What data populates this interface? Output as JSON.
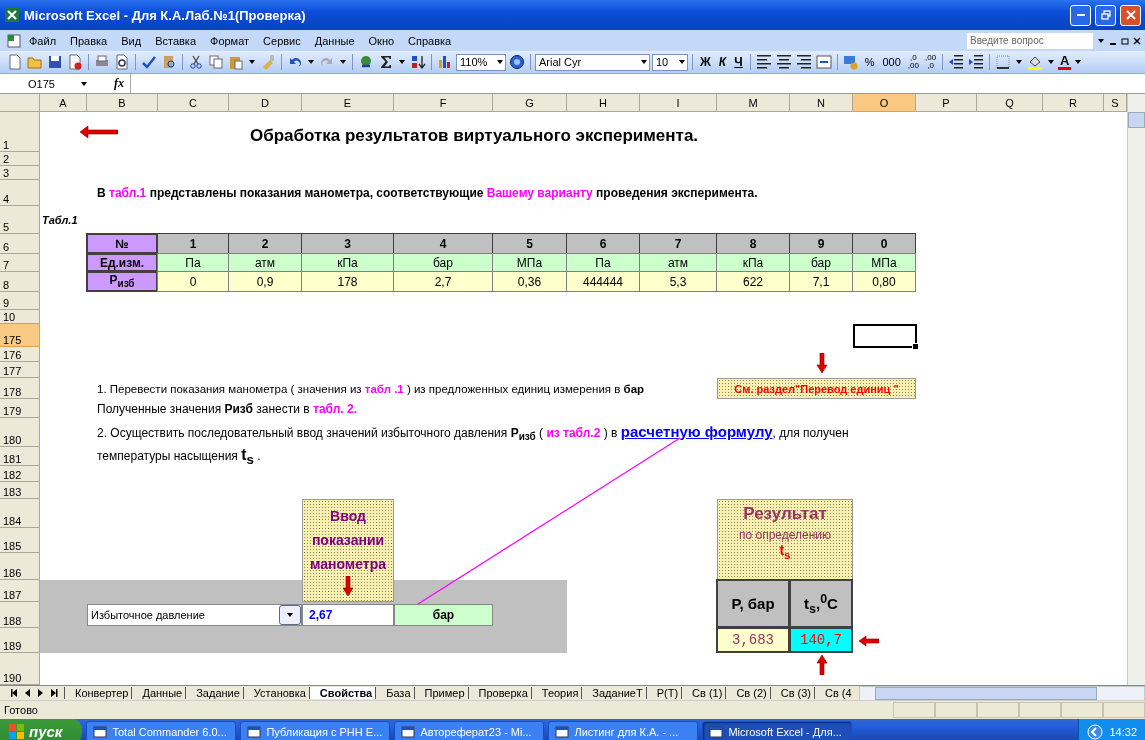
{
  "window": {
    "title": "Microsoft Excel - Для К.А.Лаб.№1(Проверка)"
  },
  "menu": [
    "Файл",
    "Правка",
    "Вид",
    "Вставка",
    "Формат",
    "Сервис",
    "Данные",
    "Окно",
    "Справка"
  ],
  "help_search": {
    "placeholder": "Введите вопрос"
  },
  "toolbar": {
    "zoom": "110%",
    "font": "Arial Cyr",
    "size": "10",
    "style_buttons": [
      "Ж",
      "К",
      "Ч"
    ],
    "number_buttons": [
      "%",
      "000"
    ],
    "decimal_buttons": [
      {
        "top": ",0",
        "bottom": ",00"
      },
      {
        "top": ",00",
        "bottom": ",0"
      }
    ],
    "font_color": "A"
  },
  "formula_bar": {
    "name_box": "O175",
    "fx": "fx"
  },
  "columns": [
    {
      "label": "A",
      "selected": false
    },
    {
      "label": "B",
      "selected": false
    },
    {
      "label": "C",
      "selected": false
    },
    {
      "label": "D",
      "selected": false
    },
    {
      "label": "E",
      "selected": false
    },
    {
      "label": "F",
      "selected": false
    },
    {
      "label": "G",
      "selected": false
    },
    {
      "label": "H",
      "selected": false
    },
    {
      "label": "I",
      "selected": false
    },
    {
      "label": "M",
      "selected": false
    },
    {
      "label": "N",
      "selected": false
    },
    {
      "label": "O",
      "selected": true
    },
    {
      "label": "P",
      "selected": false
    },
    {
      "label": "Q",
      "selected": false
    },
    {
      "label": "R",
      "selected": false
    },
    {
      "label": "S",
      "selected": false
    }
  ],
  "rows": [
    {
      "label": "1",
      "selected": false
    },
    {
      "label": "2",
      "selected": false
    },
    {
      "label": "3",
      "selected": false
    },
    {
      "label": "4",
      "selected": false
    },
    {
      "label": "5",
      "selected": false
    },
    {
      "label": "6",
      "selected": false
    },
    {
      "label": "7",
      "selected": false
    },
    {
      "label": "8",
      "selected": false
    },
    {
      "label": "9",
      "selected": false
    },
    {
      "label": "10",
      "selected": false
    },
    {
      "label": "175",
      "selected": true
    },
    {
      "label": "176",
      "selected": false
    },
    {
      "label": "177",
      "selected": false
    },
    {
      "label": "178",
      "selected": false
    },
    {
      "label": "179",
      "selected": false
    },
    {
      "label": "180",
      "selected": false
    },
    {
      "label": "181",
      "selected": false
    },
    {
      "label": "182",
      "selected": false
    },
    {
      "label": "183",
      "selected": false
    },
    {
      "label": "184",
      "selected": false
    },
    {
      "label": "185",
      "selected": false
    },
    {
      "label": "186",
      "selected": false
    },
    {
      "label": "187",
      "selected": false
    },
    {
      "label": "188",
      "selected": false
    },
    {
      "label": "189",
      "selected": false
    },
    {
      "label": "190",
      "selected": false
    }
  ],
  "sheet": {
    "heading": "Обработка результатов виртуального эксперимента.",
    "intro": [
      {
        "kind": "plain",
        "text": "В "
      },
      {
        "kind": "hl",
        "text": "табл.1"
      },
      {
        "kind": "plain",
        "text": " представлены показания манометра, соответствующие "
      },
      {
        "kind": "hl",
        "text": "Вашему варианту"
      },
      {
        "kind": "plain",
        "text": " проведения эксперимента."
      }
    ],
    "table_label": "Табл.1",
    "table1": {
      "row_headers": [
        "№",
        "Ед.изм.",
        "P$_{изб}$"
      ],
      "columns": [
        {
          "variant": "1",
          "unit": "Па",
          "value": "0"
        },
        {
          "variant": "2",
          "unit": "атм",
          "value": "0,9"
        },
        {
          "variant": "3",
          "unit": "кПа",
          "value": "178"
        },
        {
          "variant": "4",
          "unit": "бар",
          "value": "2,7"
        },
        {
          "variant": "5",
          "unit": "МПа",
          "value": "0,36"
        },
        {
          "variant": "6",
          "unit": "Па",
          "value": "444444"
        },
        {
          "variant": "7",
          "unit": "атм",
          "value": "5,3"
        },
        {
          "variant": "8",
          "unit": "кПа",
          "value": "622"
        },
        {
          "variant": "9",
          "unit": "бар",
          "value": "7,1"
        },
        {
          "variant": "0",
          "unit": "МПа",
          "value": "0,80"
        }
      ]
    },
    "step1": [
      {
        "kind": "plain",
        "text": "1. Перевести показания манометра ( значения из "
      },
      {
        "kind": "hl",
        "text": "табл .1"
      },
      {
        "kind": "plain",
        "text": " ) из предложенных единиц измерения в "
      },
      {
        "kind": "bold",
        "text": "бар"
      }
    ],
    "note": "См. раздел\"Перевод единиц \"",
    "step1b": [
      {
        "kind": "plain",
        "text": "Полученные значения "
      },
      {
        "kind": "bold",
        "text": "Ризб"
      },
      {
        "kind": "plain",
        "text": " занести в "
      },
      {
        "kind": "hl",
        "text": "табл. 2."
      }
    ],
    "step2": [
      {
        "kind": "plain",
        "text": "2. Осуществить последовательный ввод значений избыточного давления "
      },
      {
        "kind": "bold",
        "text": "P$_{изб}$"
      },
      {
        "kind": "plain",
        "text": " ( "
      },
      {
        "kind": "hl",
        "text": "из табл.2"
      },
      {
        "kind": "plain",
        "text": " )  в "
      },
      {
        "kind": "link",
        "text": "расчетную формулу"
      },
      {
        "kind": "plain",
        "text": ", для получен"
      }
    ],
    "step2b": [
      {
        "kind": "plain",
        "text": "температуры насыщения "
      },
      {
        "kind": "big",
        "text": "t$_{s}$"
      },
      {
        "kind": "plain",
        "text": " ."
      }
    ],
    "input_panel": {
      "header": "Ввод показании манометра",
      "dropdown": "Избыточное давление",
      "value": "2,67",
      "unit": "бар"
    },
    "result": {
      "title": "Результат",
      "subtitle": "по определению",
      "symbol": "t$_{s}$",
      "headers": [
        "P, бар",
        "t$_{s}$,$^{0}$C"
      ],
      "values": [
        "3,683",
        "140,7"
      ]
    }
  },
  "sheet_tabs": [
    {
      "label": "Конвертер",
      "selected": false
    },
    {
      "label": "Данные",
      "selected": false
    },
    {
      "label": "Задание",
      "selected": false
    },
    {
      "label": "Установка",
      "selected": false
    },
    {
      "label": "Свойства",
      "selected": true
    },
    {
      "label": "База",
      "selected": false
    },
    {
      "label": "Пример",
      "selected": false
    },
    {
      "label": "Проверка",
      "selected": false
    },
    {
      "label": "Теория",
      "selected": false
    },
    {
      "label": "ЗаданиеТ",
      "selected": false
    },
    {
      "label": "Р(Т)",
      "selected": false
    },
    {
      "label": "Св (1)",
      "selected": false
    },
    {
      "label": "Св (2)",
      "selected": false
    },
    {
      "label": "Св (3)",
      "selected": false
    },
    {
      "label": "Св (4",
      "selected": false
    }
  ],
  "status": "Готово",
  "taskbar": {
    "start": "пуск",
    "tasks": [
      {
        "label": "Total Commander 6.0...",
        "selected": false
      },
      {
        "label": "Публикация с РНН Е...",
        "selected": false
      },
      {
        "label": "Автореферат23 - Mi...",
        "selected": false
      },
      {
        "label": "Листинг для К.А. - ...",
        "selected": false
      },
      {
        "label": "Microsoft Excel - Для...",
        "selected": true
      }
    ],
    "clock": "14:32"
  }
}
